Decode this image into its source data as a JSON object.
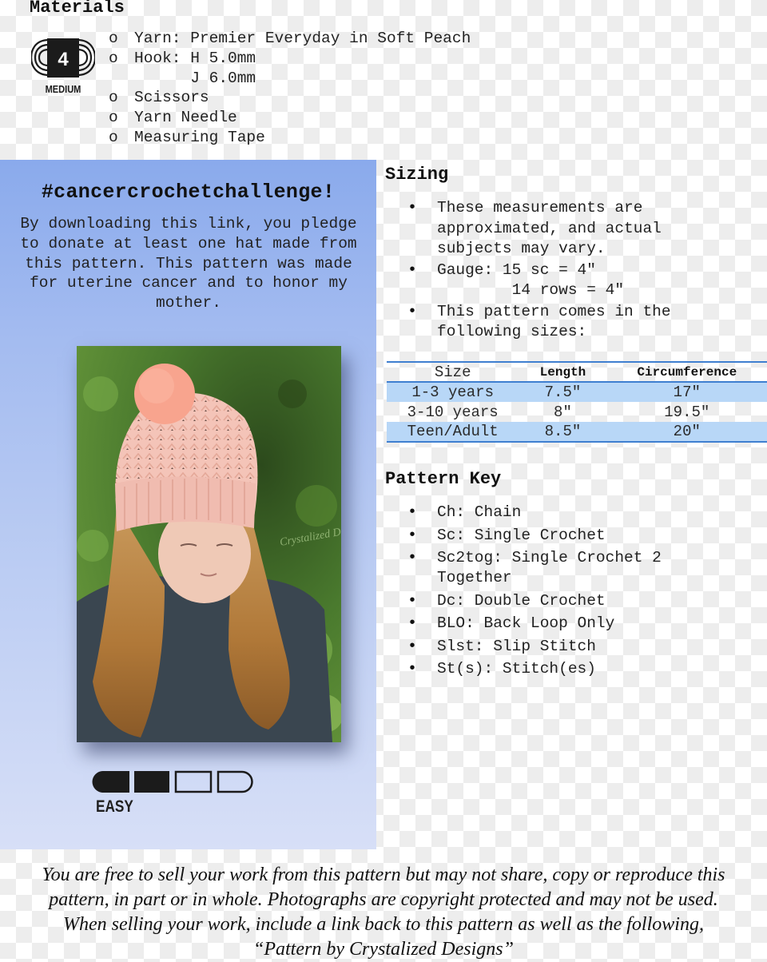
{
  "materials": {
    "title": "Materials",
    "yarn_weight_badge": {
      "number": "4",
      "label": "MEDIUM",
      "icon": "yarn-skein-icon"
    },
    "items": [
      {
        "bullet": "o",
        "text": "Yarn: Premier Everyday in Soft Peach"
      },
      {
        "bullet": "o",
        "text": "Hook: H 5.0mm"
      },
      {
        "bullet": "",
        "text": "      J 6.0mm"
      },
      {
        "bullet": "o",
        "text": "Scissors"
      },
      {
        "bullet": "o",
        "text": "Yarn Needle"
      },
      {
        "bullet": "o",
        "text": "Measuring Tape"
      }
    ]
  },
  "challenge": {
    "title": "#cancercrochetchallenge!",
    "text": "By downloading this link, you pledge to donate at least one hat made from this pattern. This pattern was made for uterine cancer and to honor my mother.",
    "photo": {
      "alt": "Girl wearing a peach crochet pom-pom hat",
      "watermark": "Crystalized Designs"
    },
    "difficulty": {
      "label": "EASY",
      "level": 2,
      "max": 4
    }
  },
  "sizing": {
    "title": "Sizing",
    "bullets": [
      "These measurements are approximated, and actual subjects may vary.",
      "Gauge: 15 sc = 4″\n        14 rows = 4″",
      "This pattern comes in the following sizes:"
    ],
    "table": {
      "headers": [
        "Size",
        "Length",
        "Circumference"
      ],
      "rows": [
        [
          "1-3 years",
          "7.5″",
          "17″"
        ],
        [
          "3-10 years",
          "8″",
          "19.5″"
        ],
        [
          "Teen/Adult",
          "8.5″",
          "20″"
        ]
      ],
      "shade_color": "#b8d7f7",
      "rule_color": "#3f7fd0"
    }
  },
  "pattern_key": {
    "title": "Pattern Key",
    "items": [
      "Ch: Chain",
      "Sc: Single Crochet",
      "Sc2tog: Single Crochet 2 Together",
      "Dc: Double Crochet",
      "BLO: Back Loop Only",
      "Slst: Slip Stitch",
      "St(s): Stitch(es)"
    ]
  },
  "license": {
    "text": "You are free to sell your work from this pattern but may not share, copy or reproduce this pattern, in part or in whole. Photographs are copyright protected and may not be used. When selling your work, include a link back to this pattern as well as the following, “Pattern by Crystalized Designs”"
  }
}
